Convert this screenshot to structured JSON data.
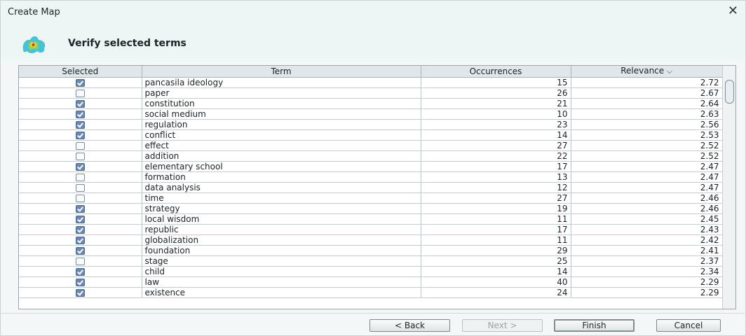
{
  "window": {
    "title": "Create Map",
    "close_glyph": "✕"
  },
  "header": {
    "subtitle": "Verify selected terms",
    "logo_icon": "vosviewer-logo-icon"
  },
  "table": {
    "columns": {
      "selected": "Selected",
      "term": "Term",
      "occurrences": "Occurrences",
      "relevance": "Relevance"
    },
    "sort_column": "relevance",
    "sort_direction": "descending",
    "rows": [
      {
        "selected": true,
        "term": "pancasila ideology",
        "occurrences": "15",
        "relevance": "2.72"
      },
      {
        "selected": false,
        "term": "paper",
        "occurrences": "26",
        "relevance": "2.67"
      },
      {
        "selected": true,
        "term": "constitution",
        "occurrences": "21",
        "relevance": "2.64"
      },
      {
        "selected": true,
        "term": "social medium",
        "occurrences": "10",
        "relevance": "2.63"
      },
      {
        "selected": true,
        "term": "regulation",
        "occurrences": "23",
        "relevance": "2.56"
      },
      {
        "selected": true,
        "term": "conflict",
        "occurrences": "14",
        "relevance": "2.53"
      },
      {
        "selected": false,
        "term": "effect",
        "occurrences": "27",
        "relevance": "2.52"
      },
      {
        "selected": false,
        "term": "addition",
        "occurrences": "22",
        "relevance": "2.52"
      },
      {
        "selected": true,
        "term": "elementary school",
        "occurrences": "17",
        "relevance": "2.47"
      },
      {
        "selected": false,
        "term": "formation",
        "occurrences": "13",
        "relevance": "2.47"
      },
      {
        "selected": false,
        "term": "data analysis",
        "occurrences": "12",
        "relevance": "2.47"
      },
      {
        "selected": false,
        "term": "time",
        "occurrences": "27",
        "relevance": "2.46"
      },
      {
        "selected": true,
        "term": "strategy",
        "occurrences": "19",
        "relevance": "2.46"
      },
      {
        "selected": true,
        "term": "local wisdom",
        "occurrences": "11",
        "relevance": "2.45"
      },
      {
        "selected": true,
        "term": "republic",
        "occurrences": "17",
        "relevance": "2.43"
      },
      {
        "selected": true,
        "term": "globalization",
        "occurrences": "11",
        "relevance": "2.42"
      },
      {
        "selected": true,
        "term": "foundation",
        "occurrences": "29",
        "relevance": "2.41"
      },
      {
        "selected": false,
        "term": "stage",
        "occurrences": "25",
        "relevance": "2.37"
      },
      {
        "selected": true,
        "term": "child",
        "occurrences": "14",
        "relevance": "2.34"
      },
      {
        "selected": true,
        "term": "law",
        "occurrences": "40",
        "relevance": "2.29"
      },
      {
        "selected": true,
        "term": "existence",
        "occurrences": "24",
        "relevance": "2.29"
      }
    ]
  },
  "buttons": {
    "back": "< Back",
    "next": "Next >",
    "finish": "Finish",
    "cancel": "Cancel"
  },
  "colors": {
    "checkbox_checked": "#6a86b3",
    "header_bg": "#e1e7e9",
    "window_bg": "#f3f7f7"
  }
}
